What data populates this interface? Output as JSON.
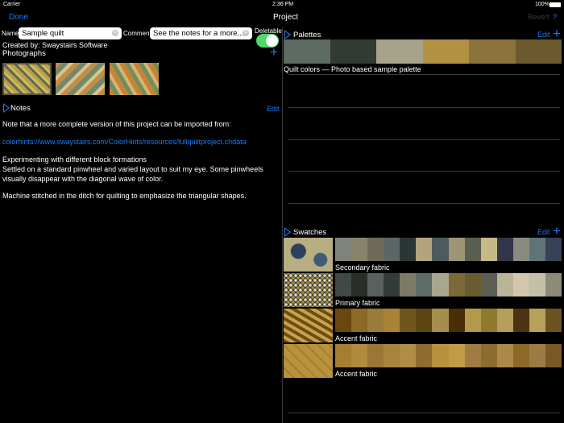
{
  "status": {
    "carrier": "Carrier",
    "time": "2:36 PM",
    "battery": "100%"
  },
  "nav": {
    "done": "Done",
    "title": "Project",
    "revert": "Revert",
    "help": "?"
  },
  "project": {
    "name_label": "Name",
    "name_value": "Sample quilt",
    "comment_label": "Comment",
    "comment_value": "See the notes for a more...",
    "deletable_label": "Deletable",
    "deletable": true,
    "created_by": "Created by: Swaystairs Software",
    "photographs_label": "Photographs"
  },
  "notes": {
    "title": "Notes",
    "edit": "Edit",
    "lines": [
      "Note that a more complete version of this project can be imported from:",
      "colorhints://www.swaystairs.com/ColorHints/resources/fullquiltproject.chdata",
      "Experimenting with different block formations",
      "Settled on a standard pinwheel and varied layout to suit my eye. Some pinwheels",
      "visually disappear with the diagonal wave of color.",
      "Machine stitched in the ditch for quilting to emphasize the triangular shapes."
    ]
  },
  "palettes": {
    "title": "Palettes",
    "edit": "Edit",
    "items": [
      {
        "label": "Quilt colors — Photo based sample palette",
        "colors": [
          "#5e6b62",
          "#323a33",
          "#a6a38a",
          "#b39143",
          "#8c733b",
          "#6c5a2e"
        ]
      }
    ]
  },
  "swatches": {
    "title": "Swatches",
    "edit": "Edit",
    "items": [
      {
        "label": "Secondary fabric",
        "colors": [
          "#7e847a",
          "#86846a",
          "#6e6b5a",
          "#5b6766",
          "#2c3536",
          "#b4a47e",
          "#4d5b5e",
          "#9f9576",
          "#5a5e4e",
          "#c5b985",
          "#30354a",
          "#8a8b7c",
          "#5f7379",
          "#374259"
        ]
      },
      {
        "label": "Primary fabric",
        "colors": [
          "#414944",
          "#2a2e28",
          "#57625e",
          "#323b36",
          "#7d7b66",
          "#5d6c66",
          "#a9a68f",
          "#7b6937",
          "#6a5b30",
          "#5d5f55",
          "#bcb496",
          "#d4c6aa",
          "#c4bfa9",
          "#8e8a78"
        ]
      },
      {
        "label": "Accent fabric",
        "colors": [
          "#6a470f",
          "#8a6a25",
          "#9a7b3a",
          "#a78534",
          "#70561a",
          "#5d4513",
          "#a68d4e",
          "#4a2e08",
          "#b49a4c",
          "#8f7a2e",
          "#b69d5a",
          "#4c3412",
          "#b9a05a",
          "#6d5220"
        ]
      },
      {
        "label": "Accent fabric",
        "colors": [
          "#a77d33",
          "#b08a3d",
          "#9b7636",
          "#a9843d",
          "#b08c45",
          "#8e6c2f",
          "#b8913e",
          "#c29a48",
          "#a07c44",
          "#8c6c31",
          "#ac8948",
          "#8e6925",
          "#9c7c44",
          "#7a5a24"
        ]
      }
    ]
  }
}
